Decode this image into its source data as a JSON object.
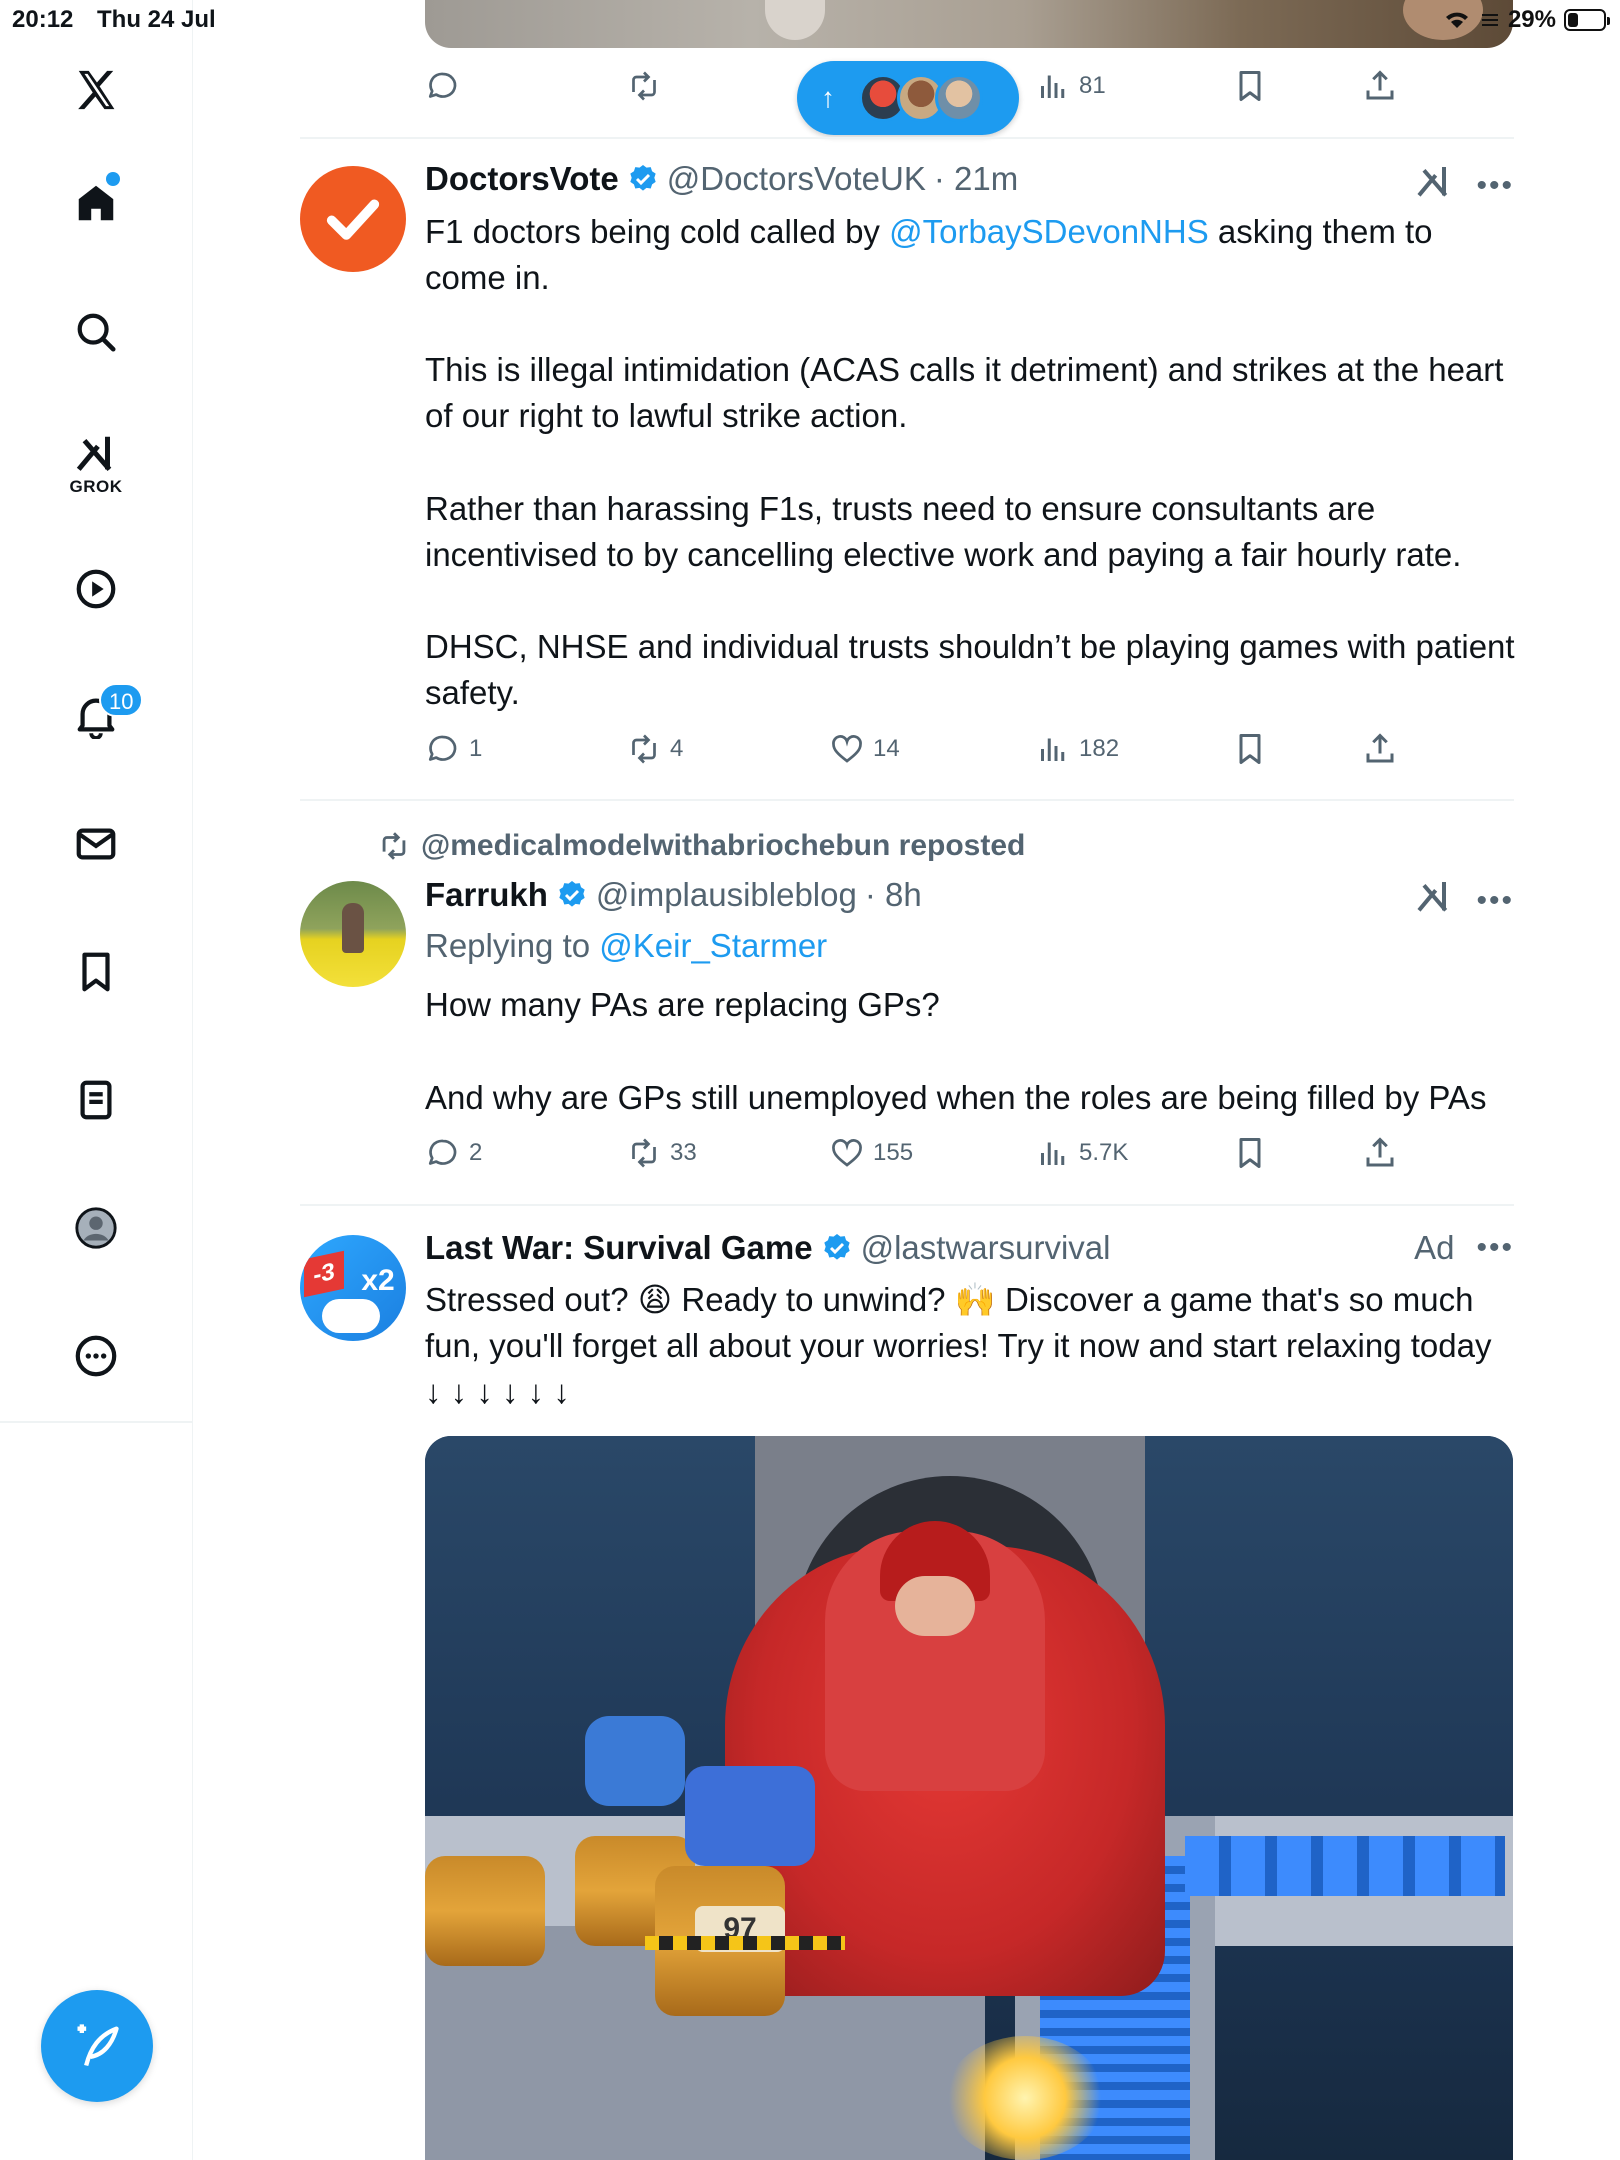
{
  "status_bar": {
    "time": "20:12",
    "date": "Thu 24 Jul",
    "battery": "29%",
    "battery_level": 0.29
  },
  "sidebar": {
    "items": [
      {
        "name": "x-logo-icon"
      },
      {
        "name": "home-icon"
      },
      {
        "name": "search-icon"
      },
      {
        "name": "grok-icon",
        "label": "GROK"
      },
      {
        "name": "video-icon"
      },
      {
        "name": "notifications-icon",
        "badge": "10"
      },
      {
        "name": "messages-icon"
      },
      {
        "name": "bookmarks-icon"
      },
      {
        "name": "lists-icon"
      },
      {
        "name": "profile-icon"
      },
      {
        "name": "more-icon"
      }
    ],
    "compose_icon": "feather-plus-icon"
  },
  "colors": {
    "accent": "#1d9bf0",
    "text": "#0f1419",
    "muted": "#536471",
    "divider": "#eff3f4",
    "doctors_avatar": "#f05a22"
  },
  "top_post": {
    "views": "81"
  },
  "new_posts_pill": {
    "arrow": "↑"
  },
  "posts": [
    {
      "display_name": "DoctorsVote",
      "handle": "@DoctorsVoteUK",
      "time": "· 21m",
      "text_before_mention": "F1 doctors being cold called by ",
      "mention": "@TorbaySDevonNHS",
      "text_after_mention": " asking them to come in.",
      "paragraphs": [
        "This is illegal intimidation (ACAS calls it detriment) and strikes at the heart of our right to lawful strike action.",
        "Rather than harassing F1s, trusts need to ensure consultants are incentivised to by cancelling elective work and paying a fair hourly rate.",
        "DHSC, NHSE and individual trusts shouldn’t be playing games with patient safety."
      ],
      "replies": "1",
      "reposts": "4",
      "likes": "14",
      "views": "182"
    },
    {
      "reposted_by": "@medicalmodelwithabriochebun reposted",
      "display_name": "Farrukh",
      "handle": "@implausibleblog",
      "time": "· 8h",
      "replying_prefix": "Replying to ",
      "replying_to": "@Keir_Starmer",
      "paragraphs": [
        "How many PAs are replacing GPs?",
        "And why are GPs still unemployed when the roles are being filled by PAs"
      ],
      "replies": "2",
      "reposts": "33",
      "likes": "155",
      "views": "5.7K"
    },
    {
      "display_name": "Last War: Survival Game",
      "handle": "@lastwarsurvival",
      "ad_label": "Ad",
      "text": "Stressed out? 😩 Ready to unwind? 🙌 Discover a game that's so much fun, you'll forget all about your worries! Try it now and start relaxing today ↓ ↓ ↓ ↓ ↓ ↓",
      "avatar_text_1": "-3",
      "avatar_text_2": "x2",
      "media_barrel_number": "97"
    }
  ]
}
